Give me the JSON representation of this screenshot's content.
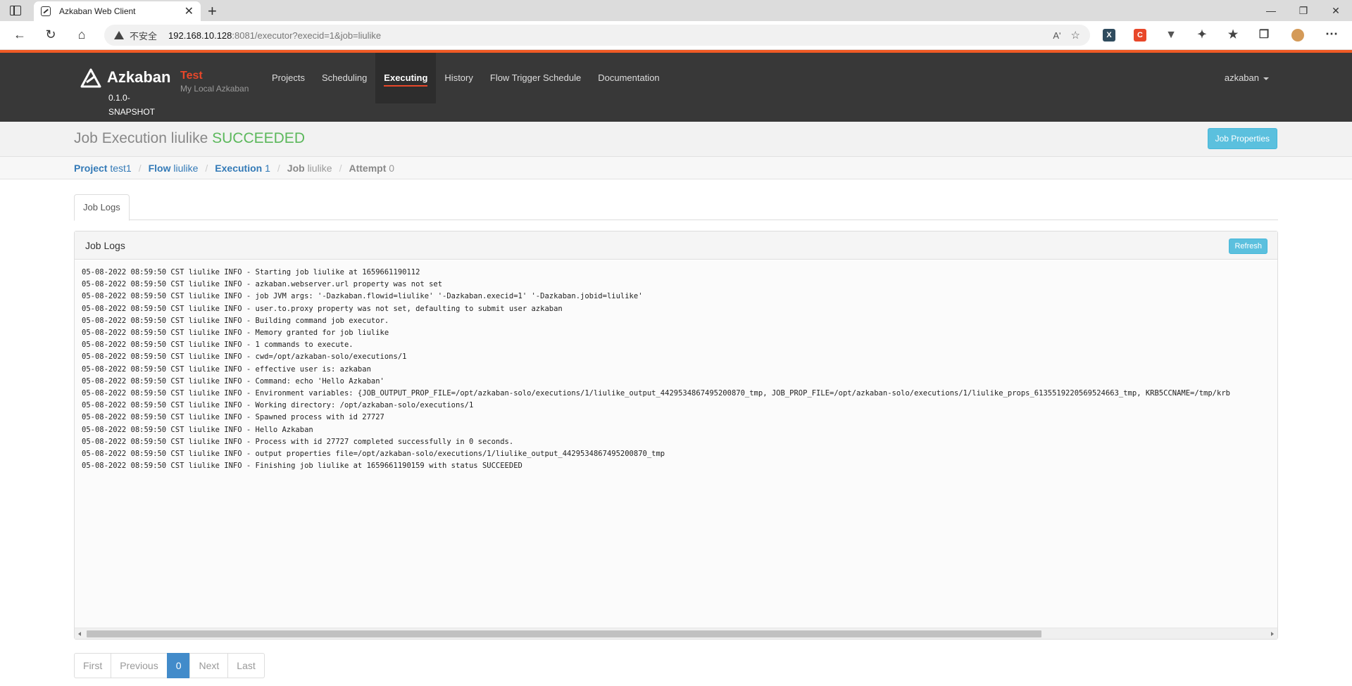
{
  "browser": {
    "tab_title": "Azkaban Web Client",
    "tab_close": "✕",
    "new_tab": "+",
    "window_controls": [
      "—",
      "❐",
      "✕"
    ],
    "insecure_label": "不安全",
    "url_host": "192.168.10.128",
    "url_rest": ":8081/executor?execid=1&job=liulike",
    "read_aloud": "Aʹ",
    "icons": [
      "back-icon",
      "reload-icon",
      "home-icon",
      "warning-icon",
      "favorites-icon",
      "collections-icon",
      "profile-avatar-icon",
      "more-icon"
    ]
  },
  "navbar": {
    "brand": "Azkaban",
    "version": "0.1.0-SNAPSHOT",
    "env_name": "Test",
    "env_desc": "My Local Azkaban",
    "menu": [
      "Projects",
      "Scheduling",
      "Executing",
      "History",
      "Flow Trigger Schedule",
      "Documentation"
    ],
    "active_menu": "Executing",
    "user": "azkaban",
    "accent_color": "#f05a24"
  },
  "header": {
    "title_prefix": "Job Execution liulike",
    "status": "SUCCEEDED",
    "status_color": "#5cb85c",
    "job_properties_button": "Job Properties"
  },
  "breadcrumb": [
    {
      "label": "Project",
      "value": "test1"
    },
    {
      "label": "Flow",
      "value": "liulike"
    },
    {
      "label": "Execution",
      "value": "1"
    },
    {
      "label": "Job",
      "value": "liulike"
    },
    {
      "label": "Attempt",
      "value": "0"
    }
  ],
  "tabs": [
    "Job Logs"
  ],
  "panel": {
    "title": "Job Logs",
    "refresh_button": "Refresh",
    "log_lines": [
      "05-08-2022 08:59:50 CST liulike INFO - Starting job liulike at 1659661190112",
      "05-08-2022 08:59:50 CST liulike INFO - azkaban.webserver.url property was not set",
      "05-08-2022 08:59:50 CST liulike INFO - job JVM args: '-Dazkaban.flowid=liulike' '-Dazkaban.execid=1' '-Dazkaban.jobid=liulike'",
      "05-08-2022 08:59:50 CST liulike INFO - user.to.proxy property was not set, defaulting to submit user azkaban",
      "05-08-2022 08:59:50 CST liulike INFO - Building command job executor.",
      "05-08-2022 08:59:50 CST liulike INFO - Memory granted for job liulike",
      "05-08-2022 08:59:50 CST liulike INFO - 1 commands to execute.",
      "05-08-2022 08:59:50 CST liulike INFO - cwd=/opt/azkaban-solo/executions/1",
      "05-08-2022 08:59:50 CST liulike INFO - effective user is: azkaban",
      "05-08-2022 08:59:50 CST liulike INFO - Command: echo 'Hello Azkaban'",
      "05-08-2022 08:59:50 CST liulike INFO - Environment variables: {JOB_OUTPUT_PROP_FILE=/opt/azkaban-solo/executions/1/liulike_output_4429534867495200870_tmp, JOB_PROP_FILE=/opt/azkaban-solo/executions/1/liulike_props_6135519220569524663_tmp, KRB5CCNAME=/tmp/krb",
      "05-08-2022 08:59:50 CST liulike INFO - Working directory: /opt/azkaban-solo/executions/1",
      "05-08-2022 08:59:50 CST liulike INFO - Spawned process with id 27727",
      "05-08-2022 08:59:50 CST liulike INFO - Hello Azkaban",
      "05-08-2022 08:59:50 CST liulike INFO - Process with id 27727 completed successfully in 0 seconds.",
      "05-08-2022 08:59:50 CST liulike INFO - output properties file=/opt/azkaban-solo/executions/1/liulike_output_4429534867495200870_tmp",
      "05-08-2022 08:59:50 CST liulike INFO - Finishing job liulike at 1659661190159 with status SUCCEEDED"
    ]
  },
  "pager": {
    "first": "First",
    "previous": "Previous",
    "current": "0",
    "next": "Next",
    "last": "Last"
  }
}
